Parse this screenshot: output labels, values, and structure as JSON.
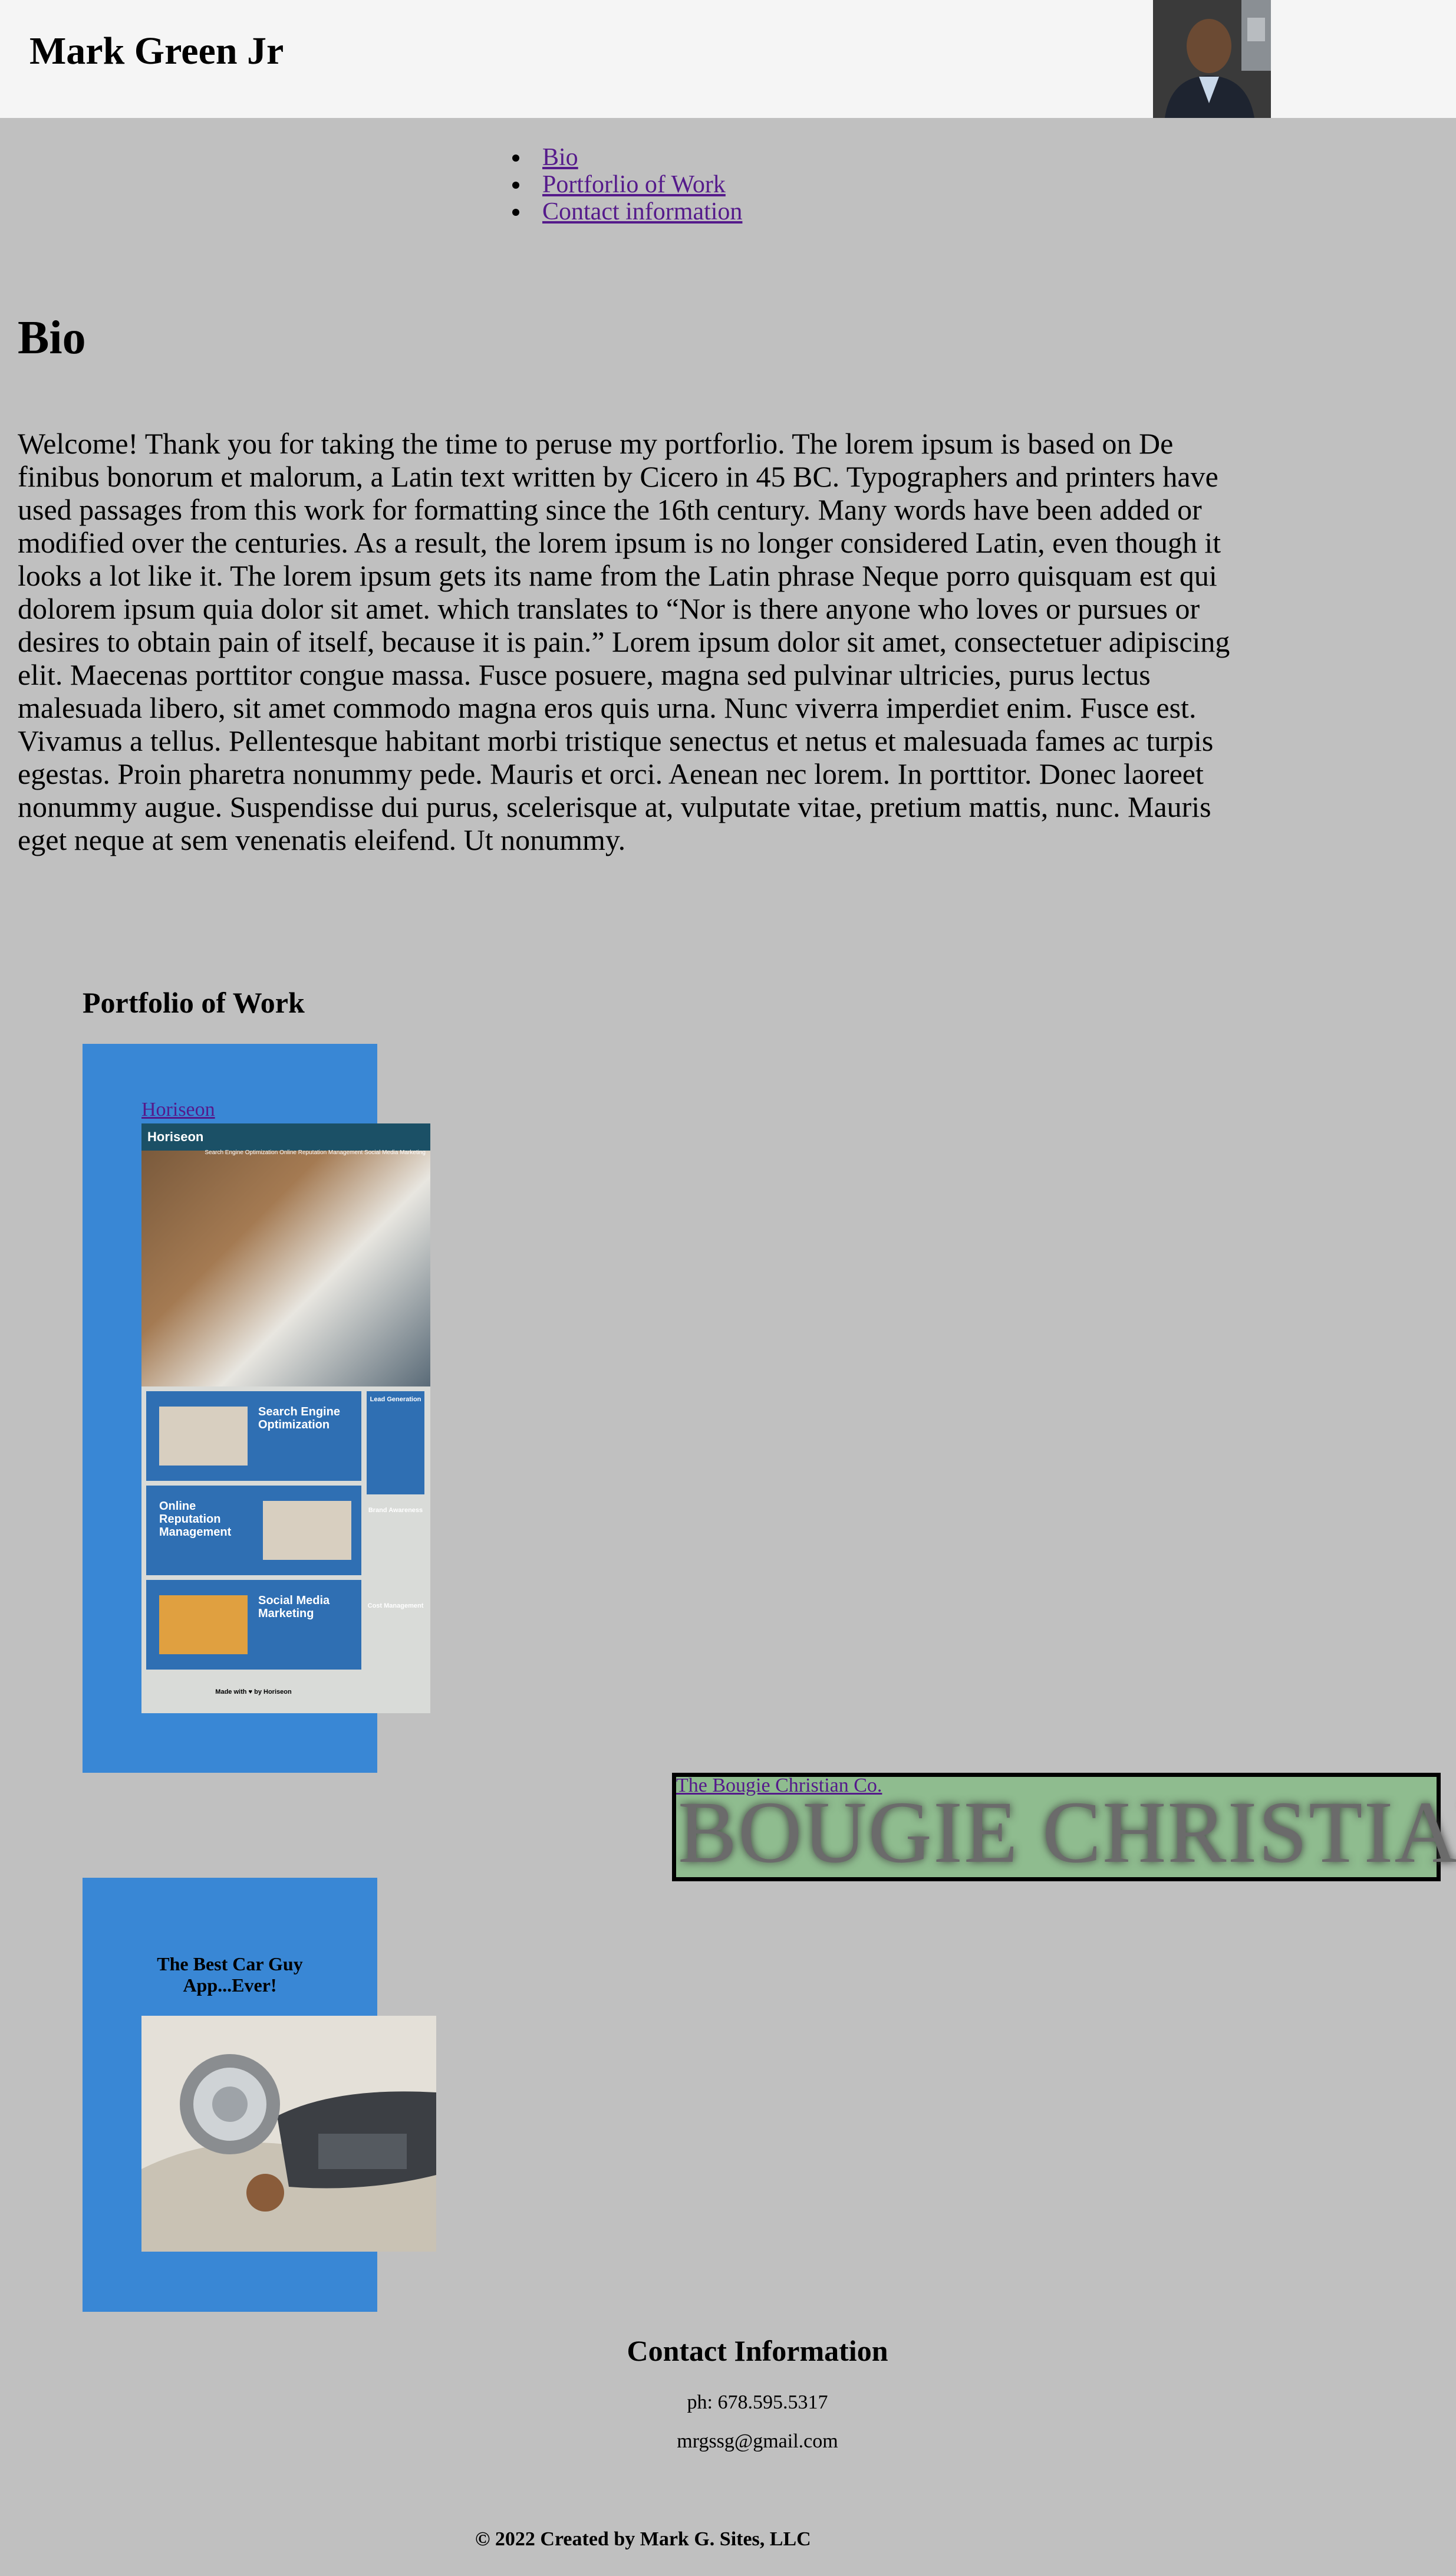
{
  "header": {
    "title": "Mark Green Jr",
    "avatar_icon": "person-portrait"
  },
  "nav": {
    "items": [
      {
        "label": "Bio"
      },
      {
        "label": "Portforlio of Work"
      },
      {
        "label": "Contact information"
      }
    ]
  },
  "bio": {
    "heading": "Bio",
    "text": "Welcome! Thank you for taking the time to peruse my portforlio. The lorem ipsum is based on De finibus bonorum et malorum, a Latin text written by Cicero in 45 BC. Typographers and printers have used passages from this work for formatting since the 16th century. Many words have been added or modified over the centuries. As a result, the lorem ipsum is no longer considered Latin, even though it looks a lot like it. The lorem ipsum gets its name from the Latin phrase Neque porro quisquam est qui dolorem ipsum quia dolor sit amet. which translates to “Nor is there anyone who loves or pursues or desires to obtain pain of itself, because it is pain.” Lorem ipsum dolor sit amet, consectetuer adipiscing elit. Maecenas porttitor congue massa. Fusce posuere, magna sed pulvinar ultricies, purus lectus malesuada libero, sit amet commodo magna eros quis urna. Nunc viverra imperdiet enim. Fusce est. Vivamus a tellus. Pellentesque habitant morbi tristique senectus et netus et malesuada fames ac turpis egestas. Proin pharetra nonummy pede. Mauris et orci. Aenean nec lorem. In porttitor. Donec laoreet nonummy augue. Suspendisse dui purus, scelerisque at, vulputate vitae, pretium mattis, nunc. Mauris eget neque at sem venenatis eleifend. Ut nonummy."
  },
  "portfolio": {
    "heading": "Portfolio of Work",
    "horiseon": {
      "link": "Horiseon",
      "screenshot": {
        "brand": "Horiseon",
        "nav": "Search Engine Optimization    Online Reputation Management    Social Media Marketing",
        "sections": [
          "Search Engine Optimization",
          "Online Reputation Management",
          "Social Media Marketing"
        ],
        "side": [
          "Lead Generation",
          "Brand Awareness",
          "Cost Management"
        ],
        "footer": "Made with ♥ by Horiseon"
      }
    },
    "bougie": {
      "link": "The Bougie Christian Co.",
      "logo": "BOUGIE CHRISTIAN"
    },
    "car": {
      "title": "The Best Car Guy App...Ever!",
      "image_icon": "vintage-car-photo"
    }
  },
  "contact": {
    "heading": "Contact Information",
    "phone": "ph: 678.595.5317",
    "email": "mrgssg@gmail.com"
  },
  "footer": {
    "text": "© 2022 Created by Mark G. Sites, LLC"
  },
  "colors": {
    "background": "#c0c0c0",
    "header_bg": "#f5f5f5",
    "card_blue": "#3987d5",
    "bougie_green": "#8fbc8f",
    "link": "#551a8b"
  }
}
